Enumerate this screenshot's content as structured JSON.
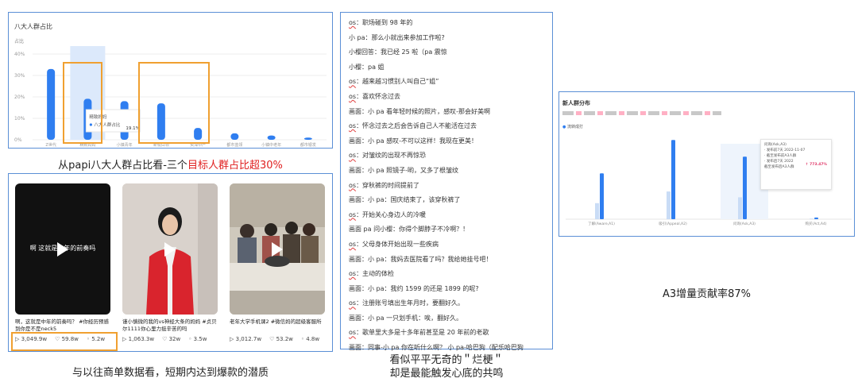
{
  "chart_panel": {
    "title": "八大人群占比",
    "chart_data": {
      "type": "bar",
      "title": "八大人群占比",
      "ylabel": "占比",
      "ylim": [
        0,
        40
      ],
      "y_ticks": [
        "40%",
        "30%",
        "20%",
        "10%",
        "0%"
      ],
      "categories": [
        "Z世代",
        "精致妈妈",
        "小镇青年",
        "新锐白领",
        "资深中产",
        "都市蓝领",
        "小镇中老年",
        "都市银发"
      ],
      "values": [
        33,
        19.1,
        18,
        17,
        5.5,
        3,
        2,
        1
      ],
      "colors": {
        "bar": "#2f7ef0",
        "bar_light": "#dce9fb"
      },
      "tooltip": {
        "title": "精致妈妈",
        "series": "八大人群占比",
        "value": "19.1%"
      }
    },
    "caption_prefix": "从papi八大人群占比看-三个",
    "caption_highlight": "目标人群占比超30%"
  },
  "videos": {
    "items": [
      {
        "overlay": "啊 这就是中年的前奏吗",
        "title": "啊，这就是中年的前奏吗？ #你经历预感到你是不是neck5",
        "plays": "3,049.9w",
        "likes": "59.8w",
        "comments": "5.2w",
        "theme": "dark"
      },
      {
        "overlay": "",
        "title": "谨小慎微的我的vs神经大条的妈妈 #贞贝尔1111你心里力挺辛苦的吗",
        "plays": "1,063.3w",
        "likes": "32w",
        "comments": "3.5w",
        "theme": "red"
      },
      {
        "overlay": "",
        "title": "老年大学手机课2 #微信妈的超级客服所",
        "plays": "3,012.7w",
        "likes": "53.2w",
        "comments": "4.8w",
        "theme": "room"
      }
    ],
    "caption": "与以往商单数据看，短期内达到爆款的潜质"
  },
  "dialogue": {
    "lines": [
      {
        "tag": "os",
        "text": "：职场碰到 98 年的"
      },
      {
        "tag": "",
        "text": "小 pa：那么小就出来参加工作啦?"
      },
      {
        "tag": "",
        "text": "小樱回答：我已经 25 啦（pa 震惊"
      },
      {
        "tag": "",
        "text": "小樱：pa 姐"
      },
      {
        "tag": "os",
        "text": "：越来越习惯别人叫自己“姐”"
      },
      {
        "tag": "os",
        "text": "：喜欢怀念过去"
      },
      {
        "tag": "",
        "text": "画面：小 pa 看年轻时候的照片，感叹-那会好美啊"
      },
      {
        "tag": "os",
        "text": "：怀念过去之后会告诉自己人不能活在过去"
      },
      {
        "tag": "",
        "text": "画面：小 pa 感叹-不可以这样！我现在更美！"
      },
      {
        "tag": "os",
        "text": "：对皱纹的出现不再惊恐"
      },
      {
        "tag": "",
        "text": "画面：小 pa 照镜子-哟，又多了根皱纹"
      },
      {
        "tag": "os",
        "text": "：穿秋裤的时间提前了"
      },
      {
        "tag": "",
        "text": "画面：小 pa：国庆结束了，该穿秋裤了"
      },
      {
        "tag": "os",
        "text": "：开始关心身边人的冷暖"
      },
      {
        "tag": "",
        "text": "画面 pa 问小樱：你得个脚脖子不冷啊？！"
      },
      {
        "tag": "os",
        "text": "：父母身体开始出现一些疾病"
      },
      {
        "tag": "",
        "text": "画面：小 pa：我妈去医院看了吗？我给她挂号吧！"
      },
      {
        "tag": "os",
        "text": "：主动的体检"
      },
      {
        "tag": "",
        "text": "画面：小 pa：我约 1599 的还是 1899 的呢?"
      },
      {
        "tag": "os",
        "text": "：注册账号填出生年月时，要翻好久。"
      },
      {
        "tag": "",
        "text": "画面：小 pa 一只划手机：唉，翻好久。"
      },
      {
        "tag": "os",
        "text": "：歌单里大多是十多年前甚至是 20 年前的老歌"
      },
      {
        "tag": "",
        "text": "画面：同事-小 pa 你在听什么啊？ 小 pa-哈巴狗（配乐哈巴狗"
      }
    ],
    "caption_line1": "看似平平无奇的＂烂梗＂",
    "caption_line2": "却是最能触发心底的共鸣"
  },
  "a3_panel": {
    "title": "新人群分布",
    "legend": "流转成打",
    "categories": [
      "了解(Aware,A1)",
      "吸引(Appeal,A2)",
      "问询(Ask,A3)",
      "购买(Act,A4)"
    ],
    "values": [
      55,
      95,
      75,
      2
    ],
    "tooltip": {
      "title": "问询(Ask,A3)",
      "date1": "· 发布前7天 2022-11-07",
      "label1": "· 截至发布前A3人群",
      "date2": "· 发布后7天 2022",
      "label2": "截至发布后A3人群",
      "growth": "↑ 773.47%"
    },
    "caption": "A3增量贡献率87%"
  }
}
